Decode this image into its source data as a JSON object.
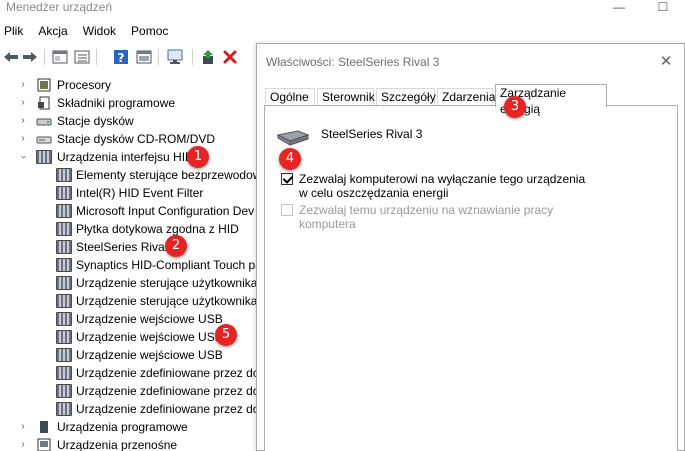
{
  "window": {
    "title": "Menedżer urządzeń",
    "minimize": "—",
    "maximize": "☐"
  },
  "menu": [
    "Plik",
    "Akcja",
    "Widok",
    "Pomoc"
  ],
  "tree": {
    "categories_top": [
      {
        "label": "Procesory"
      },
      {
        "label": "Składniki programowe"
      },
      {
        "label": "Stacje dysków"
      },
      {
        "label": "Stacje dysków CD-ROM/DVD"
      },
      {
        "label": "Urządzenia interfejsu HID"
      }
    ],
    "hid_children": [
      "Elementy sterujące bezprzewodow",
      "Intel(R) HID Event Filter",
      "Microsoft Input Configuration Dev",
      "Płytka dotykowa zgodna z HID",
      "SteelSeries Rival 3",
      "Synaptics HID-Compliant Touch pa",
      "Urządzenie sterujące użytkownika z",
      "Urządzenie sterujące użytkownika z",
      "Urządzenie wejściowe USB",
      "Urządzenie wejściowe USB",
      "Urządzenie wejściowe USB",
      "Urządzenie zdefiniowane przez dos",
      "Urządzenie zdefiniowane przez dos",
      "Urządzenie zdefiniowane przez dos"
    ],
    "categories_bottom": [
      {
        "label": "Urządzenia programowe"
      },
      {
        "label": "Urządzenia przenośne"
      }
    ]
  },
  "dialog": {
    "title": "Właściwości: SteelSeries Rival 3",
    "close": "✕",
    "tabs": [
      "Ogólne",
      "Sterownik",
      "Szczegóły",
      "Zdarzenia",
      "Zarządzanie energią"
    ],
    "active_tab": "Zarządzanie energią",
    "device_name": "SteelSeries Rival 3",
    "options": [
      {
        "label": "Zezwalaj komputerowi na wyłączanie tego urządzenia w celu oszczędzania energii",
        "checked": true,
        "disabled": false
      },
      {
        "label": "Zezwalaj temu urządzeniu na wznawianie pracy komputera",
        "checked": false,
        "disabled": true
      }
    ]
  },
  "badges": [
    "1",
    "2",
    "3",
    "4",
    "5"
  ],
  "colors": {
    "badge": "#e52424",
    "delete_icon": "#d21f1f",
    "help_icon": "#2b63c4"
  }
}
